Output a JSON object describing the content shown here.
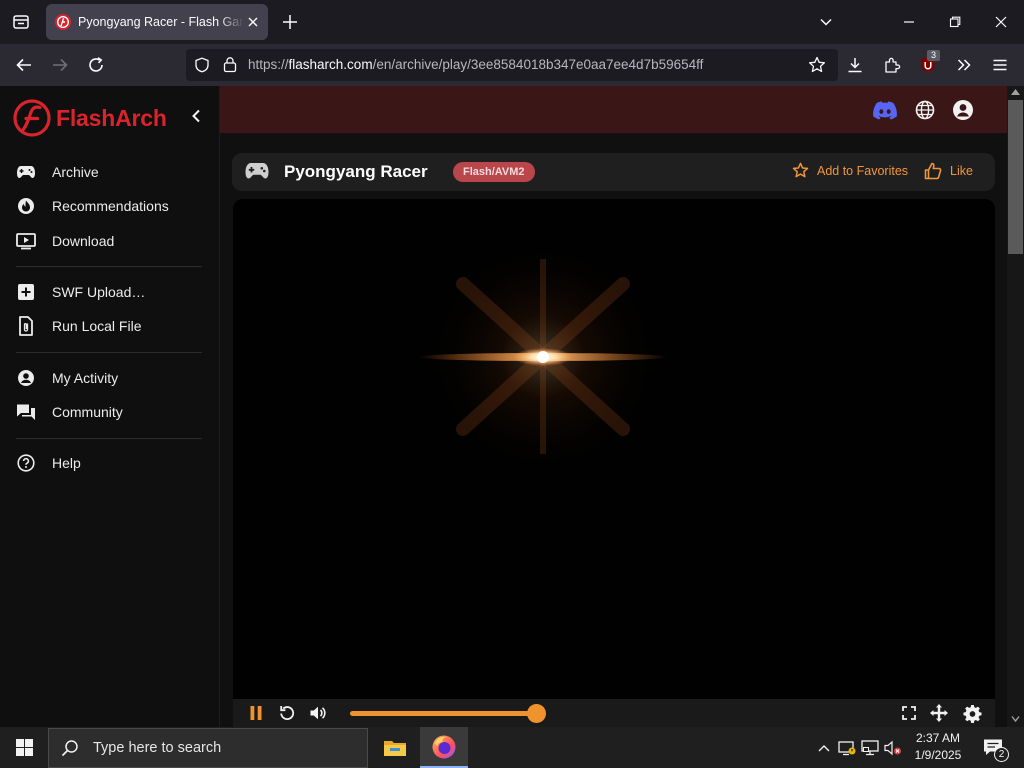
{
  "browser": {
    "tab_title": "Pyongyang Racer - Flash Games",
    "url_prefix": "https://",
    "url_domain": "flasharch.com",
    "url_path": "/en/archive/play/3ee8584018b347e0aa7ee4d7b59654ff",
    "extension_badge": "3"
  },
  "sidebar": {
    "brand": "FlashArch",
    "groups": [
      [
        {
          "label": "Archive",
          "icon": "gamepad-icon"
        },
        {
          "label": "Recommendations",
          "icon": "fire-icon"
        },
        {
          "label": "Download",
          "icon": "video-play-icon"
        }
      ],
      [
        {
          "label": "SWF Upload…",
          "icon": "plus-box-icon"
        },
        {
          "label": "Run Local File",
          "icon": "file-attach-icon"
        }
      ],
      [
        {
          "label": "My Activity",
          "icon": "account-circle-icon"
        },
        {
          "label": "Community",
          "icon": "forum-icon"
        }
      ],
      [
        {
          "label": "Help",
          "icon": "help-circle-icon"
        }
      ]
    ]
  },
  "game": {
    "title": "Pyongyang Racer",
    "format": "Flash/AVM2",
    "favorite_label": "Add to Favorites",
    "like_label": "Like",
    "volume_level": 1.0
  },
  "taskbar": {
    "search_placeholder": "Type here to search",
    "time": "2:37 AM",
    "date": "1/9/2025",
    "notification_count": "2"
  },
  "colors": {
    "brand_red": "#d9242c",
    "header_bg": "#3a1716",
    "accent_orange": "#f0922d",
    "badge_bg": "#b9464b",
    "discord_blue": "#5865f2"
  }
}
